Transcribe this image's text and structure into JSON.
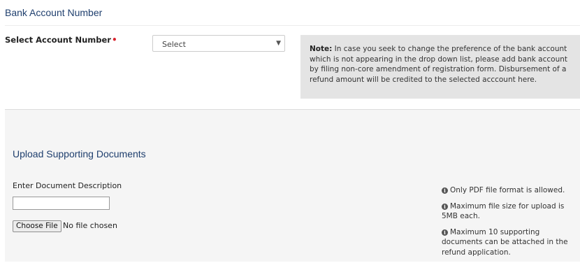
{
  "bank_section": {
    "title": "Bank Account Number",
    "field_label": "Select Account Number",
    "required_marker": "•",
    "select_value": "Select",
    "select_caret": "▼",
    "note_bold": "Note:",
    "note_text": " In case you seek to change the preference of the bank account which is not appearing in the drop down list, please add bank account by filing non-core amendment of registration form. Disbursement of a refund amount will be credited to the selected acccount here."
  },
  "upload_section": {
    "title": "Upload Supporting Documents",
    "description_label": "Enter Document Description",
    "description_value": "",
    "choose_file_label": "Choose File",
    "no_file_text": "No file chosen",
    "info_icon": "i",
    "info_items": [
      "Only PDF file format is allowed.",
      "Maximum file size for upload is 5MB each.",
      "Maximum 10 supporting documents can be attached in the refund application."
    ]
  },
  "colors": {
    "heading": "#1f3f6e",
    "required": "#d9232d",
    "note_bg": "#e4e4e4",
    "panel_bg": "#f5f5f5"
  },
  "icons": [
    "info-circle-icon",
    "dropdown-caret-icon"
  ]
}
